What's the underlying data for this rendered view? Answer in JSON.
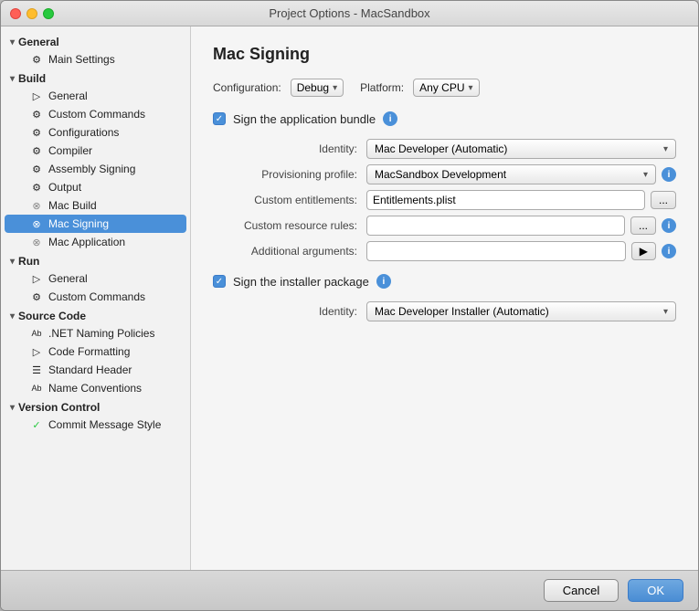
{
  "window": {
    "title": "Project Options - MacSandbox"
  },
  "sidebar": {
    "sections": [
      {
        "id": "general",
        "label": "General",
        "expanded": true,
        "items": [
          {
            "id": "main-settings",
            "label": "Main Settings",
            "icon": "⚙",
            "indent": 1
          }
        ]
      },
      {
        "id": "build",
        "label": "Build",
        "expanded": true,
        "items": [
          {
            "id": "general",
            "label": "General",
            "icon": "▷",
            "indent": 1
          },
          {
            "id": "custom-commands",
            "label": "Custom Commands",
            "icon": "⚙",
            "indent": 1
          },
          {
            "id": "configurations",
            "label": "Configurations",
            "icon": "⚙",
            "indent": 1
          },
          {
            "id": "compiler",
            "label": "Compiler",
            "icon": "⚙",
            "indent": 1
          },
          {
            "id": "assembly-signing",
            "label": "Assembly Signing",
            "icon": "⚙",
            "indent": 1
          },
          {
            "id": "output",
            "label": "Output",
            "icon": "⚙",
            "indent": 1
          },
          {
            "id": "mac-build",
            "label": "Mac Build",
            "icon": "✕",
            "indent": 1
          },
          {
            "id": "mac-signing",
            "label": "Mac Signing",
            "icon": "✕",
            "indent": 1,
            "active": true
          },
          {
            "id": "mac-application",
            "label": "Mac Application",
            "icon": "✕",
            "indent": 1
          }
        ]
      },
      {
        "id": "run",
        "label": "Run",
        "expanded": true,
        "items": [
          {
            "id": "run-general",
            "label": "General",
            "icon": "▷",
            "indent": 1
          },
          {
            "id": "run-custom-commands",
            "label": "Custom Commands",
            "icon": "⚙",
            "indent": 1
          }
        ]
      },
      {
        "id": "source-code",
        "label": "Source Code",
        "expanded": true,
        "items": [
          {
            "id": "net-naming",
            "label": ".NET Naming Policies",
            "icon": "Ab",
            "indent": 1
          },
          {
            "id": "code-formatting",
            "label": "Code Formatting",
            "icon": "▷",
            "indent": 1
          },
          {
            "id": "standard-header",
            "label": "Standard Header",
            "icon": "☰",
            "indent": 1
          },
          {
            "id": "name-conventions",
            "label": "Name Conventions",
            "icon": "Ab",
            "indent": 1
          }
        ]
      },
      {
        "id": "version-control",
        "label": "Version Control",
        "expanded": true,
        "items": [
          {
            "id": "commit-message",
            "label": "Commit Message Style",
            "icon": "✓",
            "indent": 1
          }
        ]
      }
    ]
  },
  "main": {
    "title": "Mac Signing",
    "config_label": "Configuration:",
    "config_value": "Debug",
    "platform_label": "Platform:",
    "platform_value": "Any CPU",
    "sign_bundle_label": "Sign the application bundle",
    "sign_bundle_checked": true,
    "identity_label": "Identity:",
    "identity_value": "Mac Developer (Automatic)",
    "provisioning_label": "Provisioning profile:",
    "provisioning_value": "MacSandbox Development",
    "custom_entitlements_label": "Custom entitlements:",
    "custom_entitlements_value": "Entitlements.plist",
    "custom_entitlements_btn": "...",
    "custom_resource_label": "Custom resource rules:",
    "custom_resource_value": "",
    "custom_resource_btn": "...",
    "additional_args_label": "Additional arguments:",
    "additional_args_value": "",
    "additional_args_btn": "▶",
    "sign_installer_label": "Sign the installer package",
    "sign_installer_checked": true,
    "installer_identity_label": "Identity:",
    "installer_identity_value": "Mac Developer Installer (Automatic)"
  },
  "footer": {
    "cancel_label": "Cancel",
    "ok_label": "OK"
  }
}
